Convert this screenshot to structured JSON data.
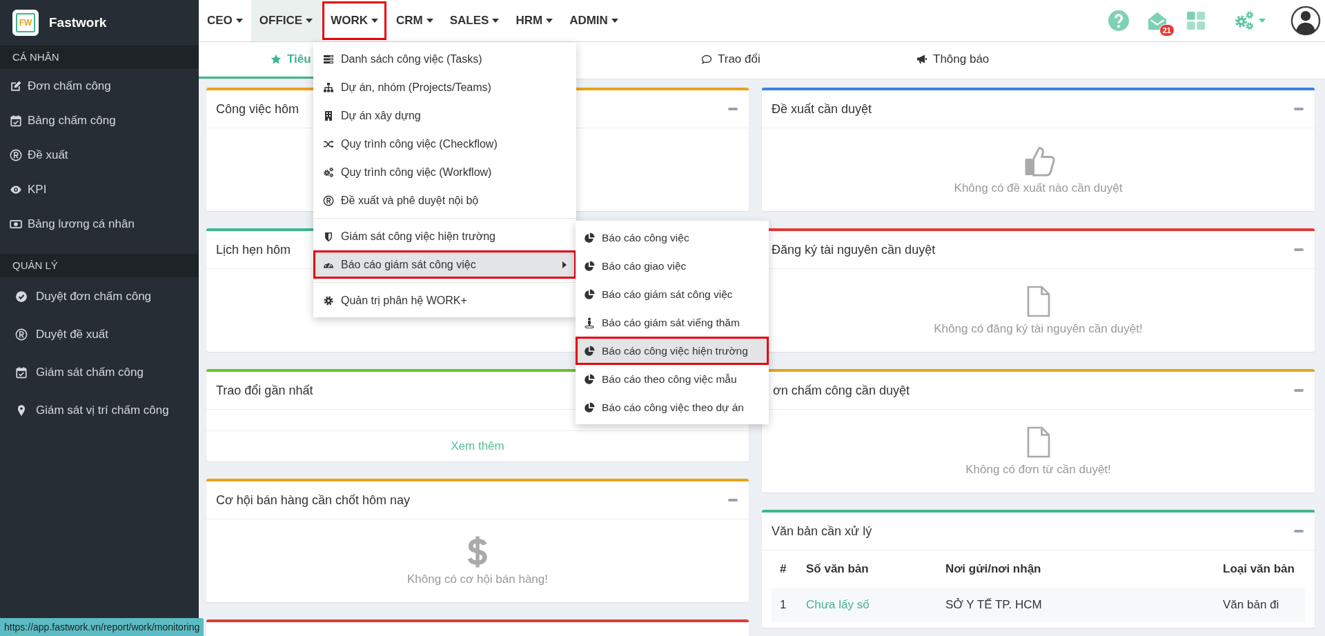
{
  "brand": {
    "logo": "FW",
    "name": "Fastwork"
  },
  "sidebar": {
    "sections": [
      {
        "title": "CÁ NHÂN",
        "items": [
          "Đơn chấm công",
          "Bảng chấm công",
          "Đề xuất",
          "KPI",
          "Bảng lương cá nhân"
        ]
      },
      {
        "title": "QUẢN LÝ",
        "items": [
          "Duyệt đơn chấm công",
          "Duyệt đề xuất",
          "Giám sát chấm công",
          "Giám sát vị trí chấm công"
        ]
      }
    ]
  },
  "nav": [
    {
      "label": "CEO",
      "selected": false,
      "annotated": false
    },
    {
      "label": "OFFICE",
      "selected": true,
      "annotated": false
    },
    {
      "label": "WORK",
      "selected": false,
      "annotated": true
    },
    {
      "label": "CRM",
      "selected": false,
      "annotated": false
    },
    {
      "label": "SALES",
      "selected": false,
      "annotated": false
    },
    {
      "label": "HRM",
      "selected": false,
      "annotated": false
    },
    {
      "label": "ADMIN",
      "selected": false,
      "annotated": false
    }
  ],
  "header": {
    "mail_badge": "21"
  },
  "tabs": [
    {
      "label": "Tiêu",
      "selected": true
    },
    {
      "label": "Trao đổi",
      "selected": false
    },
    {
      "label": "Thông báo",
      "selected": false
    }
  ],
  "work_menu": {
    "groups": [
      [
        {
          "label": "Danh sách công việc (Tasks)",
          "selected": false,
          "annotated": false,
          "has_submenu": false
        },
        {
          "label": "Dự án, nhóm (Projects/Teams)",
          "selected": false,
          "annotated": false,
          "has_submenu": false
        },
        {
          "label": "Dự án xây dựng",
          "selected": false,
          "annotated": false,
          "has_submenu": false
        },
        {
          "label": "Quy trình công việc (Checkflow)",
          "selected": false,
          "annotated": false,
          "has_submenu": false
        },
        {
          "label": "Quy trình công việc (Workflow)",
          "selected": false,
          "annotated": false,
          "has_submenu": false
        },
        {
          "label": "Đề xuất và phê duyệt nội bộ",
          "selected": false,
          "annotated": false,
          "has_submenu": false
        }
      ],
      [
        {
          "label": "Giám sát công việc hiện trường",
          "selected": false,
          "annotated": false,
          "has_submenu": false
        },
        {
          "label": "Báo cáo giám sát công việc",
          "selected": true,
          "annotated": true,
          "has_submenu": true
        }
      ],
      [
        {
          "label": "Quản trị phân hệ WORK+",
          "selected": false,
          "annotated": false,
          "has_submenu": false
        }
      ]
    ],
    "submenu": [
      {
        "label": "Báo cáo công việc",
        "selected": false,
        "annotated": false
      },
      {
        "label": "Báo cáo giao việc",
        "selected": false,
        "annotated": false
      },
      {
        "label": "Báo cáo giám sát công việc",
        "selected": false,
        "annotated": false
      },
      {
        "label": "Báo cáo giám sát viếng thăm",
        "selected": false,
        "annotated": false
      },
      {
        "label": "Báo cáo công việc hiện trường",
        "selected": true,
        "annotated": true
      },
      {
        "label": "Báo cáo theo công việc mẫu",
        "selected": false,
        "annotated": false
      },
      {
        "label": "Báo cáo công việc theo dự án",
        "selected": false,
        "annotated": false
      }
    ]
  },
  "panels": {
    "left": [
      {
        "title": "Công việc hôm",
        "color": "#e8a317",
        "kind": "blank"
      },
      {
        "title": "Lịch hẹn hôm",
        "color": "#3fb68b",
        "kind": "blank"
      },
      {
        "title": "Trao đổi gần nhất",
        "color": "#6cbf2e",
        "kind": "link",
        "link": "Xem thêm"
      },
      {
        "title": "Cơ hội bán hàng cần chốt hôm nay",
        "color": "#e8a317",
        "kind": "empty",
        "message": "Không có cơ hội bán hàng!"
      },
      {
        "color": "#e53935",
        "kind": "blank"
      }
    ],
    "right": [
      {
        "title": "Đề xuất cần duyệt",
        "color": "#3b82e6",
        "kind": "empty",
        "message": "Không có đề xuất nào cần duyệt"
      },
      {
        "title": "Đăng ký tài nguyên cần duyệt",
        "color": "#e53935",
        "kind": "empty",
        "message": "Không có đăng ký tài nguyên cần duyệt!"
      },
      {
        "title": "ơn chấm công cần duyệt",
        "color": "#e8a317",
        "kind": "empty",
        "message": "Không có đơn từ cần duyệt!"
      },
      {
        "title": "Văn bản cần xử lý",
        "color": "#3fb68b",
        "kind": "table",
        "table": {
          "columns": [
            "#",
            "Số văn bản",
            "Nơi gửi/nơi nhận",
            "Loại văn bản"
          ],
          "rows": [
            {
              "index": "1",
              "number": "Chưa lấy số",
              "party": "SỞ Y TẾ TP. HCM",
              "type": "Văn bản đi"
            }
          ]
        }
      }
    ]
  },
  "status_url": "https://app.fastwork.vn/report/work/monitoring"
}
